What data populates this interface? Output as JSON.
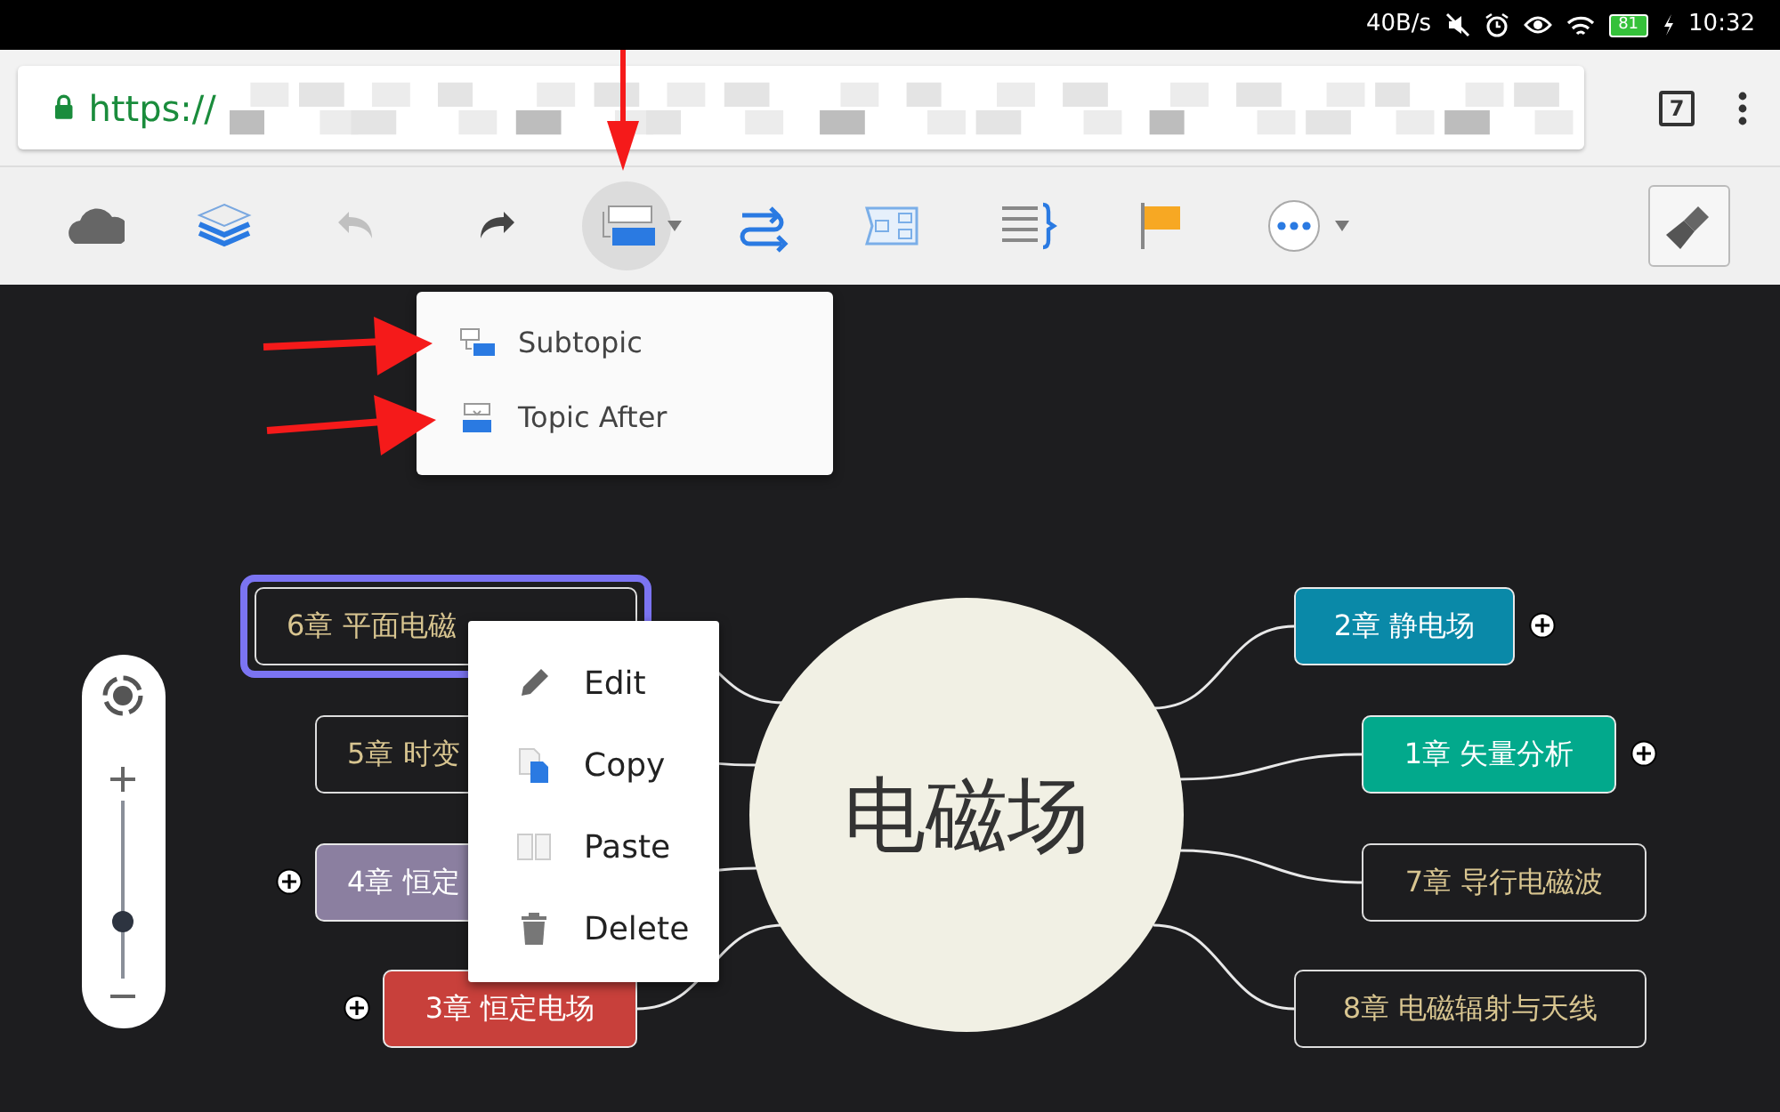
{
  "status_bar": {
    "speed": "40B/s",
    "battery": "81",
    "time": "10:32"
  },
  "browser": {
    "url": "https://",
    "tab_count": "7"
  },
  "toolbar": {
    "items": [
      {
        "kind": "cloud",
        "selected": false,
        "disabled": false
      },
      {
        "kind": "layers",
        "selected": false,
        "disabled": false
      },
      {
        "kind": "undo",
        "selected": false,
        "disabled": true
      },
      {
        "kind": "redo",
        "selected": false,
        "disabled": false
      },
      {
        "kind": "insert",
        "selected": true,
        "disabled": false
      },
      {
        "kind": "relationship",
        "selected": false,
        "disabled": false
      },
      {
        "kind": "structure",
        "selected": false,
        "disabled": false
      },
      {
        "kind": "summary",
        "selected": false,
        "disabled": false
      },
      {
        "kind": "flag",
        "selected": false,
        "disabled": false
      },
      {
        "kind": "more",
        "selected": false,
        "disabled": false
      }
    ],
    "style_button": {
      "kind": "brush"
    }
  },
  "insert_menu": {
    "items": [
      {
        "kind": "subtopic",
        "label": "Subtopic"
      },
      {
        "kind": "topic_after",
        "label": "Topic After"
      }
    ]
  },
  "mind_map": {
    "central_topic": "电磁场",
    "left_topics": [
      {
        "label": "6章 平面电磁",
        "filled": false,
        "selected": true,
        "collapsed": false
      },
      {
        "label": "5章 时变",
        "filled": false,
        "selected": false,
        "collapsed": false
      },
      {
        "label": "4章 恒定",
        "filled": true,
        "color": "#8b7fa0",
        "selected": false,
        "collapsed": true
      },
      {
        "label": "3章 恒定电场",
        "filled": true,
        "color": "#c8403b",
        "selected": false,
        "collapsed": true
      }
    ],
    "right_topics": [
      {
        "label": "2章 静电场",
        "filled": true,
        "color": "#0a89a8",
        "selected": false,
        "collapsed": true
      },
      {
        "label": "1章 矢量分析",
        "filled": true,
        "color": "#02a98c",
        "selected": false,
        "collapsed": true
      },
      {
        "label": "7章 导行电磁波",
        "filled": false,
        "selected": false,
        "collapsed": false
      },
      {
        "label": "8章 电磁辐射与天线",
        "filled": false,
        "selected": false,
        "collapsed": false
      }
    ]
  },
  "context_menu": {
    "items": [
      {
        "kind": "edit",
        "label": "Edit"
      },
      {
        "kind": "copy",
        "label": "Copy"
      },
      {
        "kind": "paste",
        "label": "Paste"
      },
      {
        "kind": "delete",
        "label": "Delete"
      }
    ]
  },
  "zoom_control": {
    "level": 0.3
  }
}
